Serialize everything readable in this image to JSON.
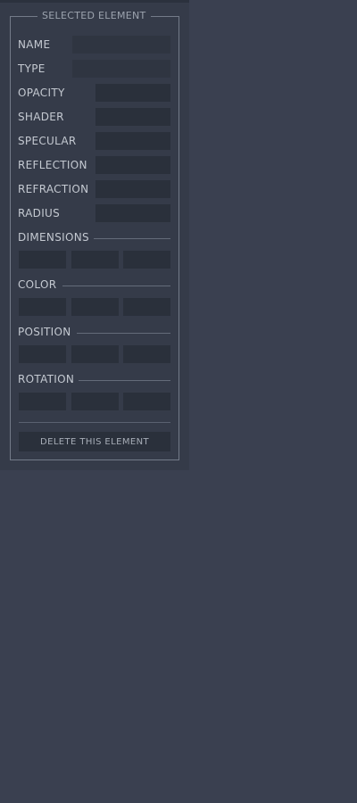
{
  "panel": {
    "legend": "SELECTED ELEMENT",
    "fields": {
      "name": {
        "label": "NAME",
        "value": ""
      },
      "type": {
        "label": "TYPE",
        "value": ""
      },
      "opacity": {
        "label": "OPACITY",
        "value": ""
      },
      "shader": {
        "label": "SHADER",
        "value": ""
      },
      "specular": {
        "label": "SPECULAR",
        "value": ""
      },
      "reflection": {
        "label": "REFLECTION",
        "value": ""
      },
      "refraction": {
        "label": "REFRACTION",
        "value": ""
      },
      "radius": {
        "label": "RADIUS",
        "value": ""
      }
    },
    "sections": {
      "dimensions": {
        "label": "DIMENSIONS",
        "values": [
          "",
          "",
          ""
        ]
      },
      "color": {
        "label": "COLOR",
        "values": [
          "",
          "",
          ""
        ]
      },
      "position": {
        "label": "POSITION",
        "values": [
          "",
          "",
          ""
        ]
      },
      "rotation": {
        "label": "ROTATION",
        "values": [
          "",
          "",
          ""
        ]
      }
    },
    "delete_label": "DELETE THIS ELEMENT"
  },
  "colors": {
    "background": "#3a4050",
    "panel": "#353b49",
    "field": "#2a303b",
    "label_text": "#c4c9d1",
    "border": "#737b89"
  }
}
